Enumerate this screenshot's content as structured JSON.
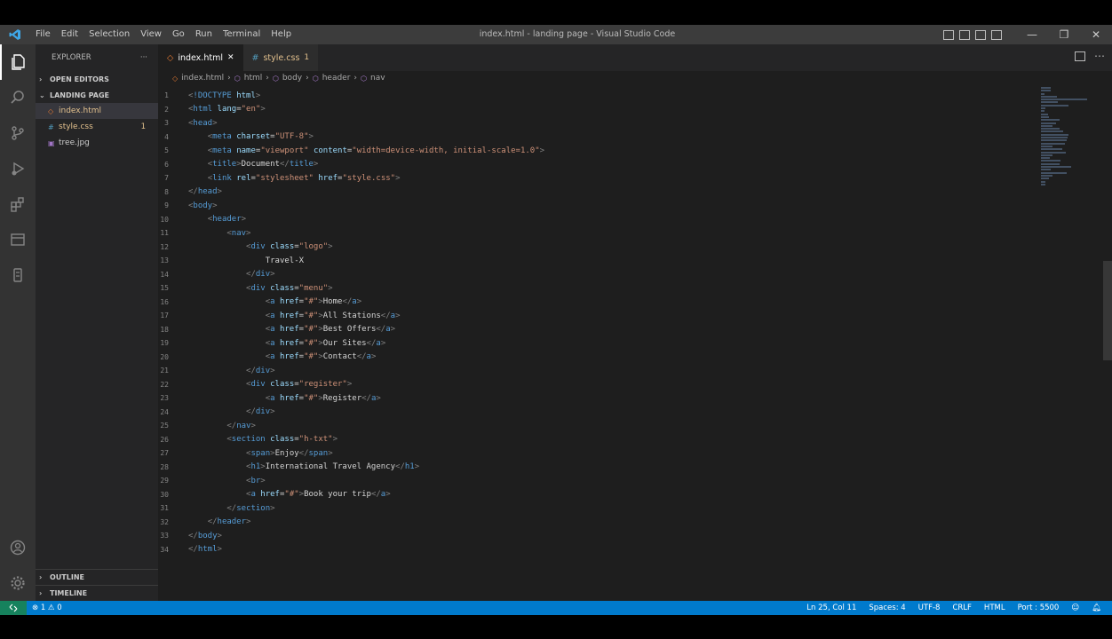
{
  "menu": {
    "items": [
      "File",
      "Edit",
      "Selection",
      "View",
      "Go",
      "Run",
      "Terminal",
      "Help"
    ]
  },
  "window": {
    "title": "index.html - landing page - Visual Studio Code"
  },
  "sidebar": {
    "header": "EXPLORER",
    "more": "···",
    "open_editors": "OPEN EDITORS",
    "folder": "LANDING PAGE",
    "files": [
      {
        "name": "index.html",
        "icon": "html-icon",
        "selected": true,
        "badge": ""
      },
      {
        "name": "style.css",
        "icon": "css-icon",
        "selected": false,
        "badge": "1"
      },
      {
        "name": "tree.jpg",
        "icon": "image-icon",
        "selected": false,
        "badge": ""
      }
    ],
    "outline": "OUTLINE",
    "timeline": "TIMELINE"
  },
  "tabs": [
    {
      "label": "index.html",
      "close": "✕",
      "active": true
    },
    {
      "label": "style.css",
      "close": "1",
      "active": false
    }
  ],
  "breadcrumb": [
    "index.html",
    "html",
    "body",
    "header",
    "nav"
  ],
  "breadcrumb_sep": "›",
  "code_lines": [
    {
      "n": "1",
      "text": "<!DOCTYPE html>"
    },
    {
      "n": "2",
      "text": "<html lang=\"en\">"
    },
    {
      "n": "3",
      "text": "<head>"
    },
    {
      "n": "4",
      "text": "    <meta charset=\"UTF-8\">"
    },
    {
      "n": "5",
      "text": "    <meta name=\"viewport\" content=\"width=device-width, initial-scale=1.0\">"
    },
    {
      "n": "6",
      "text": "    <title>Document</title>"
    },
    {
      "n": "7",
      "text": "    <link rel=\"stylesheet\" href=\"style.css\">"
    },
    {
      "n": "8",
      "text": "</head>"
    },
    {
      "n": "9",
      "text": "<body>"
    },
    {
      "n": "10",
      "text": "    <header>"
    },
    {
      "n": "11",
      "text": "        <nav>"
    },
    {
      "n": "12",
      "text": "            <div class=\"logo\">"
    },
    {
      "n": "13",
      "text": "                Travel-X"
    },
    {
      "n": "14",
      "text": "            </div>"
    },
    {
      "n": "15",
      "text": "            <div class=\"menu\">"
    },
    {
      "n": "16",
      "text": "                <a href=\"#\">Home</a>"
    },
    {
      "n": "17",
      "text": "                <a href=\"#\">All Stations</a>"
    },
    {
      "n": "18",
      "text": "                <a href=\"#\">Best Offers</a>"
    },
    {
      "n": "19",
      "text": "                <a href=\"#\">Our Sites</a>"
    },
    {
      "n": "20",
      "text": "                <a href=\"#\">Contact</a>"
    },
    {
      "n": "21",
      "text": "            </div>"
    },
    {
      "n": "22",
      "text": "            <div class=\"register\">"
    },
    {
      "n": "23",
      "text": "                <a href=\"#\">Register</a>"
    },
    {
      "n": "24",
      "text": "            </div>"
    },
    {
      "n": "25",
      "text": "        </nav>"
    },
    {
      "n": "26",
      "text": "        <section class=\"h-txt\">"
    },
    {
      "n": "27",
      "text": "            <span>Enjoy</span>"
    },
    {
      "n": "28",
      "text": "            <h1>International Travel Agency</h1>"
    },
    {
      "n": "29",
      "text": "            <br>"
    },
    {
      "n": "30",
      "text": "            <a href=\"#\">Book your trip</a>"
    },
    {
      "n": "31",
      "text": "        </section>"
    },
    {
      "n": "32",
      "text": "    </header>"
    },
    {
      "n": "33",
      "text": "</body>"
    },
    {
      "n": "34",
      "text": "</html>"
    }
  ],
  "status": {
    "errors": "⊗ 1 ⚠ 0",
    "position": "Ln 25, Col 11",
    "spaces": "Spaces: 4",
    "encoding": "UTF-8",
    "eol": "CRLF",
    "language": "HTML",
    "port": "Port : 5500"
  },
  "colors": {
    "titlebar": "#3c3c3c",
    "activitybar": "#333333",
    "sidebar": "#252526",
    "editor": "#1e1e1e",
    "statusbar": "#007acc",
    "tag": "#569cd6",
    "attr": "#9cdcfe",
    "string": "#ce9178"
  }
}
